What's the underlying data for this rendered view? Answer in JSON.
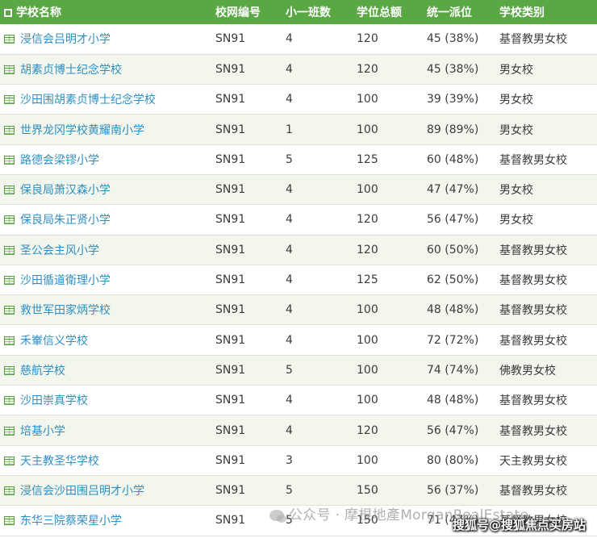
{
  "headers": {
    "name": "学校名称",
    "net": "校网编号",
    "classes": "小一班数",
    "places": "学位总额",
    "central": "统一派位",
    "type": "学校类别"
  },
  "rows": [
    {
      "name": "浸信会吕明才小学",
      "net": "SN91",
      "classes": "4",
      "places": "120",
      "central": "45 (38%)",
      "type": "基督教男女校"
    },
    {
      "name": "胡素贞博士纪念学校",
      "net": "SN91",
      "classes": "4",
      "places": "120",
      "central": "45 (38%)",
      "type": "男女校"
    },
    {
      "name": "沙田围胡素贞博士纪念学校",
      "net": "SN91",
      "classes": "4",
      "places": "100",
      "central": "39 (39%)",
      "type": "男女校"
    },
    {
      "name": "世界龙冈学校黄耀南小学",
      "net": "SN91",
      "classes": "1",
      "places": "100",
      "central": "89 (89%)",
      "type": "男女校"
    },
    {
      "name": "路德会梁镠小学",
      "net": "SN91",
      "classes": "5",
      "places": "125",
      "central": "60 (48%)",
      "type": "基督教男女校"
    },
    {
      "name": "保良局萧汉森小学",
      "net": "SN91",
      "classes": "4",
      "places": "100",
      "central": "47 (47%)",
      "type": "男女校"
    },
    {
      "name": "保良局朱正贤小学",
      "net": "SN91",
      "classes": "4",
      "places": "120",
      "central": "56 (47%)",
      "type": "男女校"
    },
    {
      "name": "圣公会主风小学",
      "net": "SN91",
      "classes": "4",
      "places": "120",
      "central": "60 (50%)",
      "type": "基督教男女校"
    },
    {
      "name": "沙田循道衛理小学",
      "net": "SN91",
      "classes": "4",
      "places": "125",
      "central": "62 (50%)",
      "type": "基督教男女校"
    },
    {
      "name": "救世军田家炳学校",
      "net": "SN91",
      "classes": "4",
      "places": "100",
      "central": "48 (48%)",
      "type": "基督教男女校"
    },
    {
      "name": "禾輋信义学校",
      "net": "SN91",
      "classes": "4",
      "places": "100",
      "central": "72 (72%)",
      "type": "基督教男女校"
    },
    {
      "name": "慈航学校",
      "net": "SN91",
      "classes": "5",
      "places": "100",
      "central": "74 (74%)",
      "type": "佛教男女校"
    },
    {
      "name": "沙田崇真学校",
      "net": "SN91",
      "classes": "4",
      "places": "100",
      "central": "48 (48%)",
      "type": "基督教男女校"
    },
    {
      "name": "培基小学",
      "net": "SN91",
      "classes": "4",
      "places": "120",
      "central": "56 (47%)",
      "type": "基督教男女校"
    },
    {
      "name": "天主教圣华学校",
      "net": "SN91",
      "classes": "3",
      "places": "100",
      "central": "80 (80%)",
      "type": "天主教男女校"
    },
    {
      "name": "浸信会沙田围吕明才小学",
      "net": "SN91",
      "classes": "5",
      "places": "150",
      "central": "56 (37%)",
      "type": "基督教男女校"
    },
    {
      "name": "东华三院蔡荣星小学",
      "net": "SN91",
      "classes": "5",
      "places": "150",
      "central": "71 (47%)",
      "type": "基督教男女校"
    }
  ],
  "watermark": "公众号 · 摩根地產MorganRealEstate",
  "corner_mark": "搜狐号@搜狐焦点买房站",
  "icons": {
    "header": "checkbox-icon",
    "row": "table-icon"
  },
  "colors": {
    "header_bg": "#5aa843",
    "link": "#2e8fc4",
    "alt_row": "#f2f6ec"
  }
}
